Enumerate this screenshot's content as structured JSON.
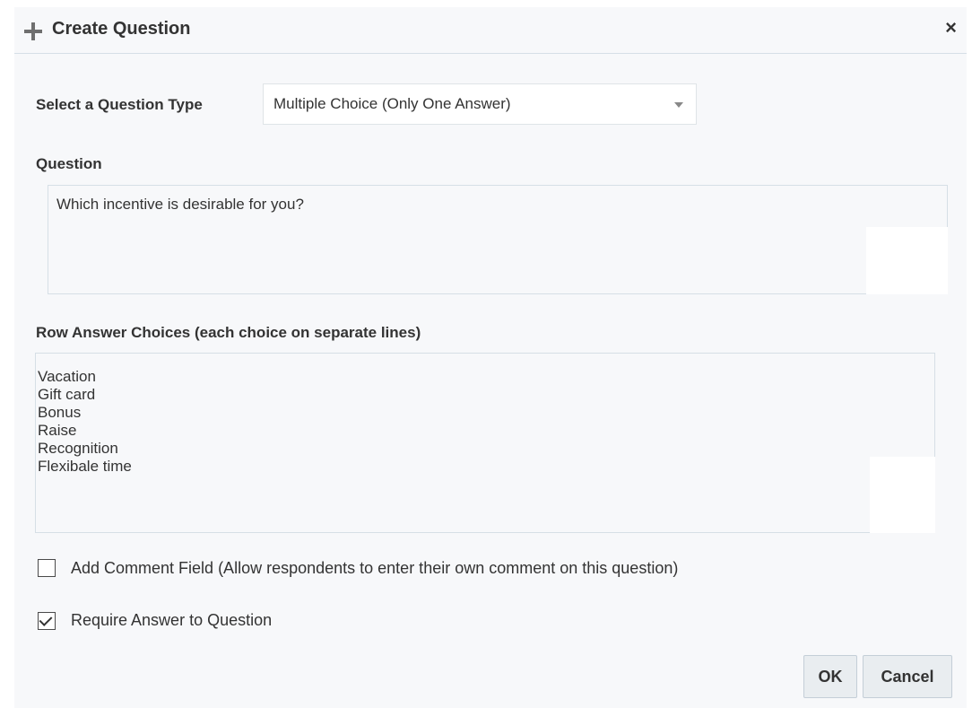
{
  "dialog": {
    "title": "Create Question",
    "close_label": "×",
    "question_type": {
      "label": "Select a Question Type",
      "selected": "Multiple Choice (Only One Answer)"
    },
    "question": {
      "label": "Question",
      "value": "Which incentive is desirable for you?"
    },
    "row_answers": {
      "label": "Row Answer Choices (each choice on separate lines)",
      "choices": [
        "Vacation",
        "Gift card",
        "Bonus",
        "Raise",
        "Recognition",
        "Flexibale time"
      ]
    },
    "add_comment": {
      "label": "Add Comment Field (Allow respondents to enter their own comment on this question)",
      "checked": false
    },
    "require_answer": {
      "label": "Require Answer to Question",
      "checked": true
    },
    "buttons": {
      "ok": "OK",
      "cancel": "Cancel"
    }
  }
}
